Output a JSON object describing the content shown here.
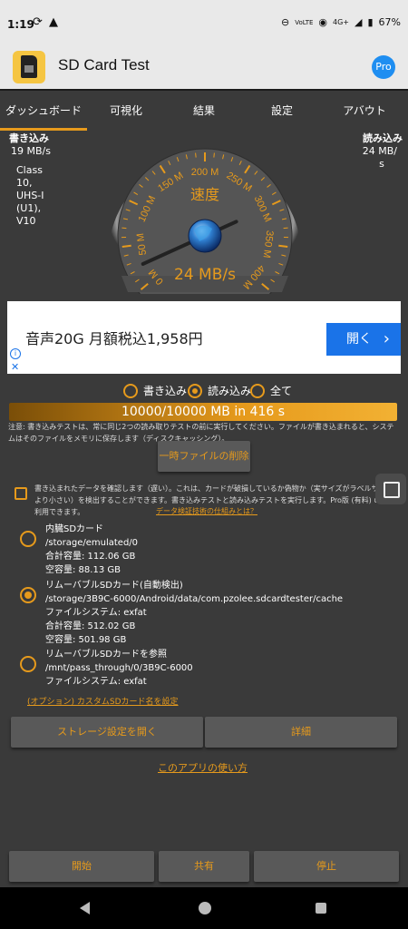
{
  "status_bar": {
    "time": "1:19",
    "battery": "67%",
    "network": "4G+",
    "volte": "VoLTE"
  },
  "app_bar": {
    "title": "SD Card Test",
    "pro_label": "Pro"
  },
  "tabs": [
    "ダッシュボード",
    "可視化",
    "結果",
    "設定",
    "アバウト"
  ],
  "write": {
    "label": "書き込み",
    "value": "19 MB/s",
    "class_info": [
      "Class",
      "10,",
      "UHS-I",
      "(U1),",
      "V10"
    ]
  },
  "read": {
    "label": "読み込み",
    "value": [
      "24 MB/",
      "s"
    ]
  },
  "gauge": {
    "title": "速度",
    "value_text": "24 MB/s",
    "value": 24,
    "max": 400,
    "ticks": [
      "0 M",
      "50 M",
      "100 M",
      "150 M",
      "200 M",
      "250 M",
      "300 M",
      "350 M",
      "400 M"
    ]
  },
  "ad": {
    "text": "音声20G 月額税込1,958円",
    "button": "開く",
    "button_arrow": "›",
    "info": "i",
    "close": "✕"
  },
  "mode": {
    "options": [
      "書き込み",
      "読み込み",
      "全て"
    ],
    "selected": 1
  },
  "progress": {
    "text": "10000/10000 MB in 416 s",
    "fraction": 1.0
  },
  "note": "注意: 書き込みテストは、常に同じ2つの読み取りテストの前に実行してください。ファイルが書き込まれると、システムはそのファイルをメモリに保存します（ディスクキャッシング）。",
  "delete_temp_button": "一時ファイルの削除",
  "verify": {
    "text": "書き込まれたデータを確認します（遅い）。これは、カードが破損しているか偽物か（実サイズがラベルサイズより小さい）を検出することができます。書き込みテストと読み込みテストを実行します。Pro版 (有料) のみ利用できます。",
    "link": "データ検証技術の仕組みとは？"
  },
  "sd_options": [
    {
      "selected": false,
      "lines": [
        "内臓SDカード",
        "/storage/emulated/0",
        "合計容量: 112.06 GB",
        "空容量: 88.13 GB"
      ]
    },
    {
      "selected": true,
      "lines": [
        "リムーバブルSDカード(自動検出)",
        "/storage/3B9C-6000/Android/data/com.pzolee.sdcardtester/cache",
        "ファイルシステム: exfat",
        "合計容量: 512.02 GB",
        "空容量: 501.98 GB"
      ]
    },
    {
      "selected": false,
      "lines": [
        "リムーバブルSDカードを参照",
        "/mnt/pass_through/0/3B9C-6000",
        "ファイルシステム: exfat"
      ]
    }
  ],
  "custom_name_link": "(オプション) カスタムSDカード名を設定",
  "storage_settings_button": "ストレージ設定を開く",
  "details_button": "詳細",
  "how_to_link": "このアプリの使い方",
  "bottom": {
    "start": "開始",
    "share": "共有",
    "stop": "停止"
  },
  "colors": {
    "accent": "#e69a1c",
    "panel": "#3a3a3a",
    "button": "#595959",
    "pro": "#1f8ef1"
  }
}
